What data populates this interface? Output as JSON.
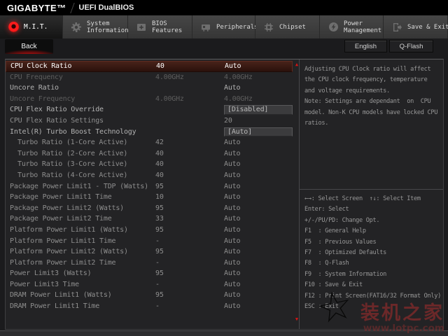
{
  "header": {
    "brand": "GIGABYTE™",
    "firmware_title": "UEFI DualBIOS"
  },
  "tabs": [
    {
      "id": "mit",
      "label_lines": [
        "M.I.T."
      ],
      "icon": "mit-dot-icon",
      "active": true
    },
    {
      "id": "system-information",
      "label_lines": [
        "System",
        "Information"
      ],
      "icon": "gear-icon",
      "active": false
    },
    {
      "id": "bios-features",
      "label_lines": [
        "BIOS",
        "Features"
      ],
      "icon": "drive-plus-icon",
      "active": false
    },
    {
      "id": "peripherals",
      "label_lines": [
        "Peripherals"
      ],
      "icon": "peripherals-icon",
      "active": false
    },
    {
      "id": "chipset",
      "label_lines": [
        "Chipset"
      ],
      "icon": "chip-icon",
      "active": false
    },
    {
      "id": "power-management",
      "label_lines": [
        "Power",
        "Management"
      ],
      "icon": "power-bolt-icon",
      "active": false
    },
    {
      "id": "save-exit",
      "label_lines": [
        "Save & Exit"
      ],
      "icon": "exit-icon",
      "active": false
    }
  ],
  "nav": {
    "back_label": "Back",
    "language_button": "English",
    "qflash_button": "Q-Flash"
  },
  "settings": {
    "rows": [
      {
        "label": "CPU Clock Ratio",
        "value": "40",
        "option": "Auto",
        "state": "selected",
        "boxed": false,
        "indent": false
      },
      {
        "label": "CPU Frequency",
        "value": "4.00GHz",
        "option": "4.00GHz",
        "state": "dim",
        "boxed": false,
        "indent": false
      },
      {
        "label": "Uncore Ratio",
        "value": "",
        "option": "Auto",
        "state": "normal",
        "boxed": false,
        "indent": false
      },
      {
        "label": "Uncore Frequency",
        "value": "4.00GHz",
        "option": "4.00GHz",
        "state": "dim",
        "boxed": false,
        "indent": false
      },
      {
        "label": "CPU Flex Ratio Override",
        "value": "",
        "option": "[Disabled]",
        "state": "normal",
        "boxed": true,
        "indent": false
      },
      {
        "label": "CPU Flex Ratio Settings",
        "value": "",
        "option": "20",
        "state": "sub",
        "boxed": false,
        "indent": false
      },
      {
        "label": "Intel(R) Turbo Boost Technology",
        "value": "",
        "option": "[Auto]",
        "state": "normal",
        "boxed": true,
        "indent": false
      },
      {
        "label": "Turbo Ratio (1-Core Active)",
        "value": "42",
        "option": "Auto",
        "state": "sub",
        "boxed": false,
        "indent": true
      },
      {
        "label": "Turbo Ratio (2-Core Active)",
        "value": "40",
        "option": "Auto",
        "state": "sub",
        "boxed": false,
        "indent": true
      },
      {
        "label": "Turbo Ratio (3-Core Active)",
        "value": "40",
        "option": "Auto",
        "state": "sub",
        "boxed": false,
        "indent": true
      },
      {
        "label": "Turbo Ratio (4-Core Active)",
        "value": "40",
        "option": "Auto",
        "state": "sub",
        "boxed": false,
        "indent": true
      },
      {
        "label": "Package Power Limit1 - TDP (Watts)",
        "value": "95",
        "option": "Auto",
        "state": "sub",
        "boxed": false,
        "indent": false
      },
      {
        "label": "Package Power Limit1 Time",
        "value": "10",
        "option": "Auto",
        "state": "sub",
        "boxed": false,
        "indent": false
      },
      {
        "label": "Package Power Limit2 (Watts)",
        "value": "95",
        "option": "Auto",
        "state": "sub",
        "boxed": false,
        "indent": false
      },
      {
        "label": "Package Power Limit2 Time",
        "value": "33",
        "option": "Auto",
        "state": "sub",
        "boxed": false,
        "indent": false
      },
      {
        "label": "Platform Power Limit1 (Watts)",
        "value": "95",
        "option": "Auto",
        "state": "sub",
        "boxed": false,
        "indent": false
      },
      {
        "label": "Platform Power Limit1 Time",
        "value": "-",
        "option": "Auto",
        "state": "sub",
        "boxed": false,
        "indent": false
      },
      {
        "label": "Platform Power Limit2 (Watts)",
        "value": "95",
        "option": "Auto",
        "state": "sub",
        "boxed": false,
        "indent": false
      },
      {
        "label": "Platform Power Limit2 Time",
        "value": "-",
        "option": "Auto",
        "state": "sub",
        "boxed": false,
        "indent": false
      },
      {
        "label": "Power Limit3 (Watts)",
        "value": "95",
        "option": "Auto",
        "state": "sub",
        "boxed": false,
        "indent": false
      },
      {
        "label": "Power Limit3 Time",
        "value": "-",
        "option": "Auto",
        "state": "sub",
        "boxed": false,
        "indent": false
      },
      {
        "label": "DRAM Power Limit1 (Watts)",
        "value": "95",
        "option": "Auto",
        "state": "sub",
        "boxed": false,
        "indent": false
      },
      {
        "label": "DRAM Power Limit1 Time",
        "value": "-",
        "option": "Auto",
        "state": "sub",
        "boxed": false,
        "indent": false
      }
    ]
  },
  "help": {
    "lines": [
      "Adjusting CPU Clock ratio will affect",
      "the CPU clock frequency, temperature",
      "and voltage requirements.",
      "Note: Settings are dependant  on  CPU",
      "model. Non-K CPU models have locked CPU",
      "ratios."
    ]
  },
  "shortcuts": [
    "←→: Select Screen  ↑↓: Select Item",
    "Enter: Select",
    "+/-/PU/PD: Change Opt.",
    "F1  : General Help",
    "F5  : Previous Values",
    "F7  : Optimized Defaults",
    "F8  : Q-Flash",
    "F9  : System Information",
    "F10 : Save & Exit",
    "F12 : Print Screen(FAT16/32 Format Only)",
    "ESC : Exit"
  ],
  "watermark": {
    "site_name": "装机之家",
    "site_url": "www.lotpc.com"
  },
  "colors": {
    "brand_red": "#cc1111",
    "selected_row_bg": "#3f1d16",
    "tab_bar_bg": "#3d3d3d",
    "panel_bg": "#232325",
    "panel_border": "#4a4a4a",
    "value_box_bg": "#3b3b3d",
    "scroll_arrow": "#d81414",
    "text_normal": "#b2b2b2",
    "text_dim": "#5e5e5e",
    "text_sub": "#8e8e8e"
  }
}
